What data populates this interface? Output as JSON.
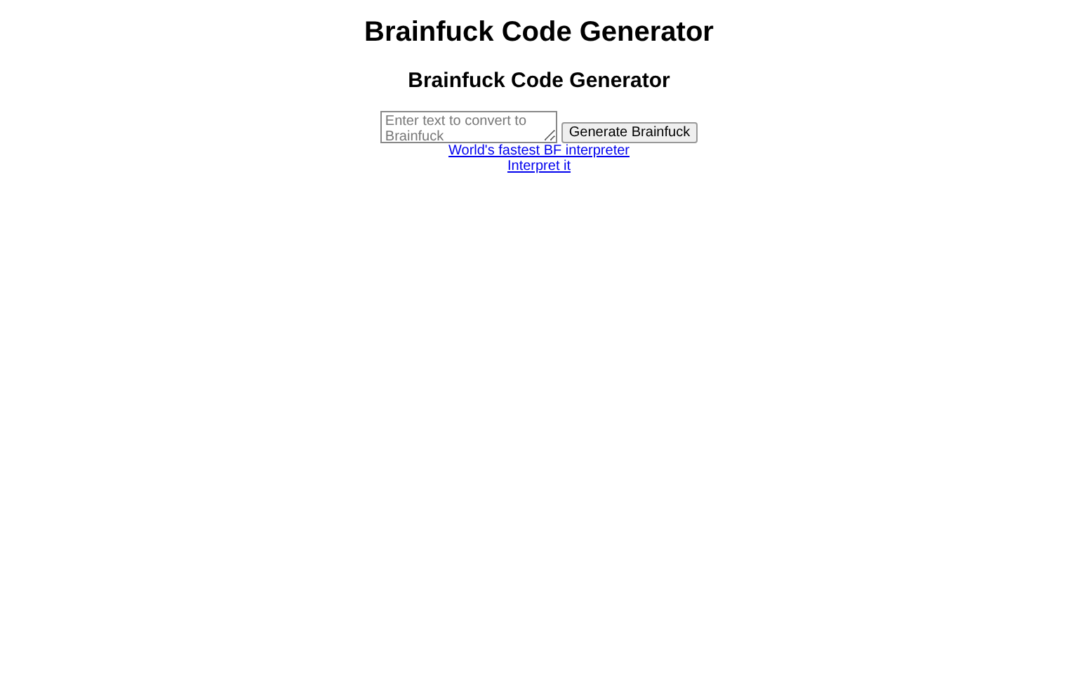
{
  "page_title": "Brainfuck Code Generator",
  "heading": "Brainfuck Code Generator",
  "input": {
    "placeholder": "Enter text to convert to Brainfuck"
  },
  "button": "Generate Brainfuck",
  "links": [
    "World's fastest BF interpreter",
    "Interpret it"
  ]
}
